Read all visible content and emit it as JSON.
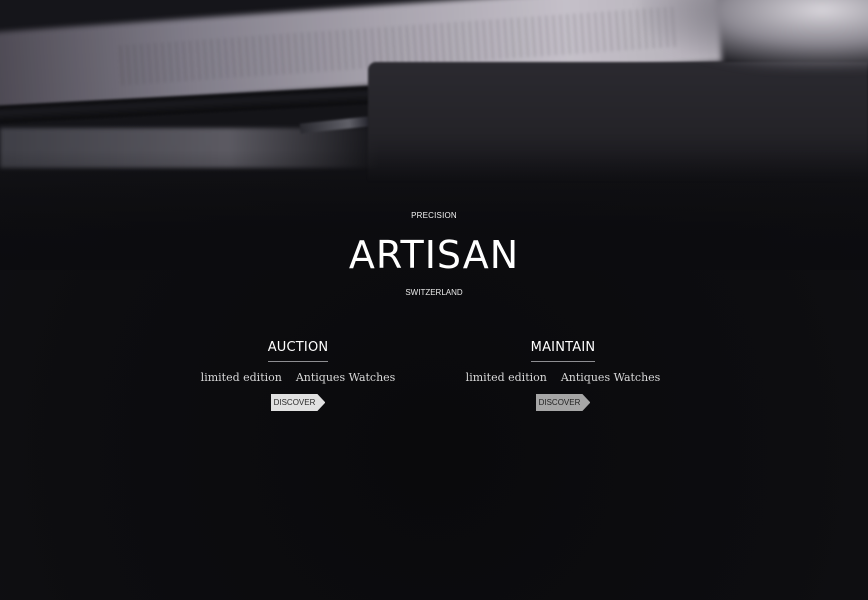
{
  "hero": {
    "kicker": "PRECISION",
    "brand": "ARTISAN",
    "subtitle": "SWITZERLAND"
  },
  "columns": [
    {
      "heading": "AUCTION",
      "tags": [
        "limited edition",
        "Antiques Watches"
      ],
      "button_label": "DISCOVER"
    },
    {
      "heading": "MAINTAIN",
      "tags": [
        "limited edition",
        "Antiques Watches"
      ],
      "button_label": "DISCOVER"
    }
  ],
  "colors": {
    "background": "#0b0b0d",
    "text": "#ffffff",
    "tag_text": "#d9d9d9",
    "button_left": "#e1e1e1",
    "button_right": "#a6a6a6"
  }
}
